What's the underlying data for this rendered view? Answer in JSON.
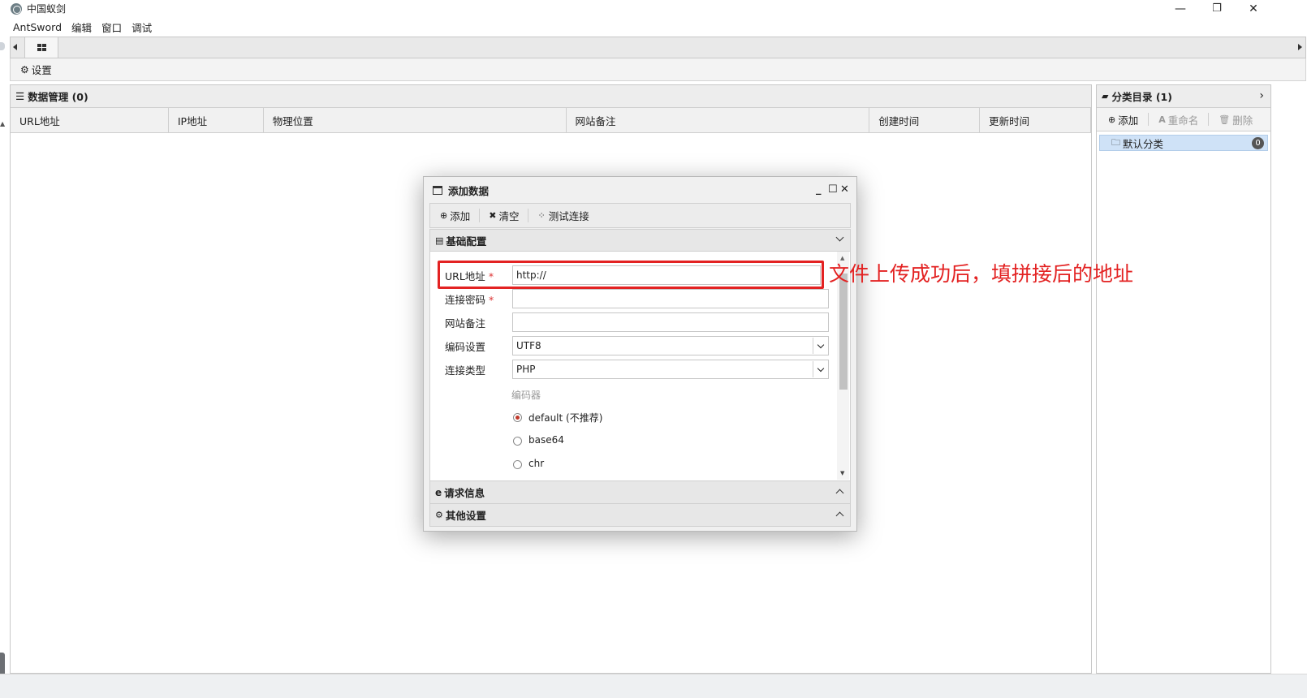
{
  "window": {
    "title": "中国蚁剑",
    "minimize": "—",
    "restore": "❐",
    "close": "✕"
  },
  "menu": [
    "AntSword",
    "编辑",
    "窗口",
    "调试"
  ],
  "settings_tab": {
    "icon": "gear-icon",
    "label": "设置"
  },
  "data_panel": {
    "title": "数据管理 (0)",
    "columns": [
      "URL地址",
      "IP地址",
      "物理位置",
      "网站备注",
      "创建时间",
      "更新时间"
    ]
  },
  "category_panel": {
    "title": "分类目录 (1)",
    "toolbar": {
      "add": "添加",
      "rename": "重命名",
      "delete": "删除"
    },
    "items": [
      {
        "label": "默认分类",
        "count": "0"
      }
    ]
  },
  "dialog": {
    "title": "添加数据",
    "toolbar": {
      "add": "添加",
      "clear": "清空",
      "test": "测试连接"
    },
    "sections": {
      "basic": "基础配置",
      "request": "请求信息",
      "other": "其他设置"
    },
    "form": {
      "url_label": "URL地址",
      "url_value": "http://",
      "password_label": "连接密码",
      "password_value": "",
      "note_label": "网站备注",
      "note_value": "",
      "encoding_label": "编码设置",
      "encoding_value": "UTF8",
      "type_label": "连接类型",
      "type_value": "PHP",
      "encoder_label": "编码器",
      "required_mark": "*",
      "encoders": [
        {
          "label": "default (不推荐)",
          "selected": true
        },
        {
          "label": "base64",
          "selected": false
        },
        {
          "label": "chr",
          "selected": false
        }
      ]
    }
  },
  "annotation": {
    "text": "文件上传成功后，填拼接后的地址",
    "color": "#e32222"
  }
}
